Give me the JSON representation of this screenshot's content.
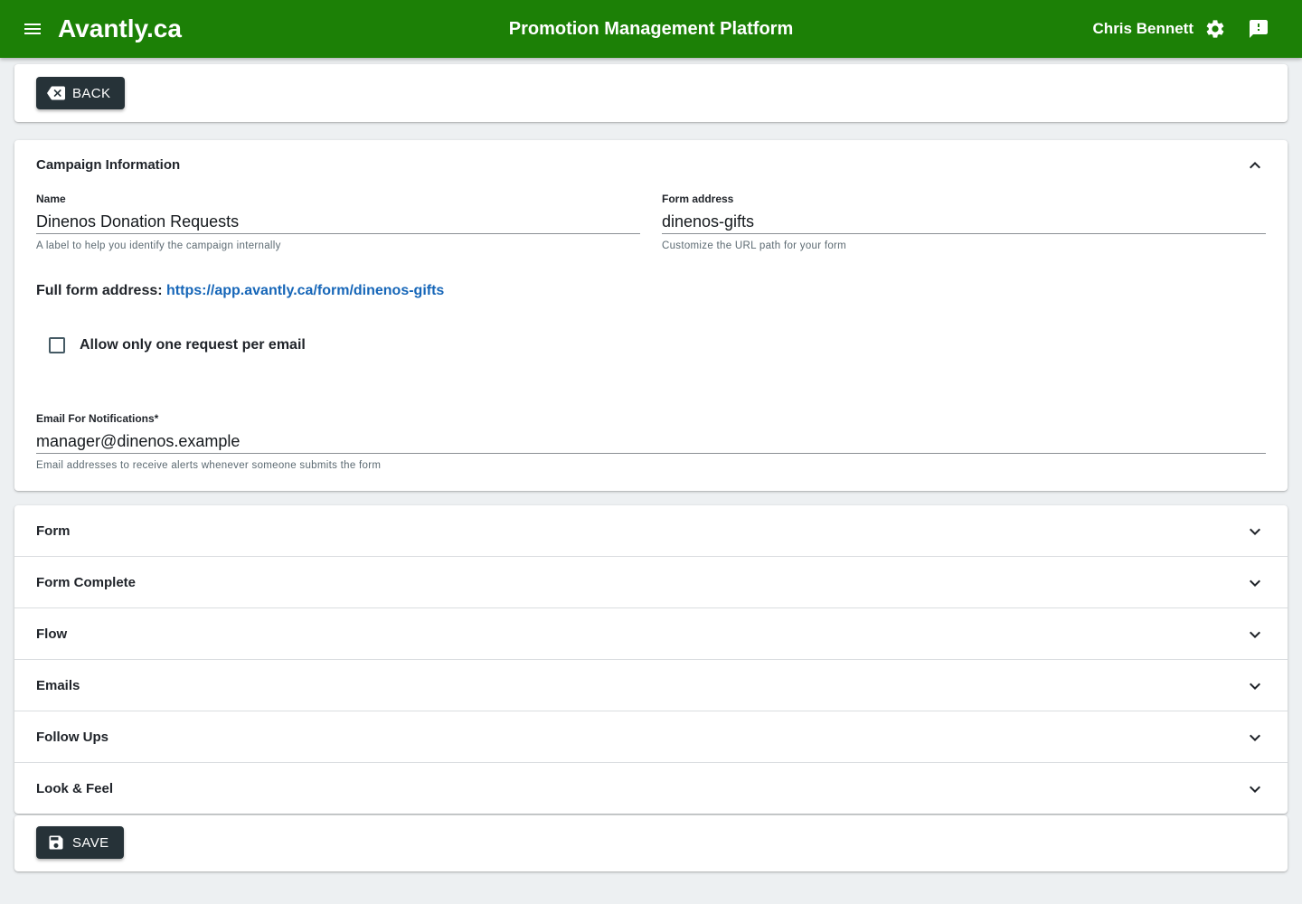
{
  "header": {
    "brand": "Avantly.ca",
    "title": "Promotion Management Platform",
    "user_name": "Chris Bennett",
    "bar_color": "#1c8006"
  },
  "back_card": {
    "back_label": "BACK"
  },
  "campaign": {
    "title": "Campaign Information",
    "name": {
      "label": "Name",
      "value": "Dinenos Donation Requests",
      "help": "A label to help you identify the campaign internally"
    },
    "form_address": {
      "label": "Form address",
      "value": "dinenos-gifts",
      "help": "Customize the URL path for your form"
    },
    "full_address_label": "Full form address: ",
    "full_address_url": "https://app.avantly.ca/form/dinenos-gifts",
    "one_request_label": "Allow only one request per email",
    "notifications": {
      "label": "Email For Notifications*",
      "value": "manager@dinenos.example",
      "help": "Email addresses to receive alerts whenever someone submits the form"
    }
  },
  "sections": [
    {
      "label": "Form"
    },
    {
      "label": "Form Complete"
    },
    {
      "label": "Flow"
    },
    {
      "label": "Emails"
    },
    {
      "label": "Follow Ups"
    },
    {
      "label": "Look & Feel"
    }
  ],
  "save_card": {
    "save_label": "SAVE"
  },
  "icons": {
    "menu": "menu-icon",
    "settings": "gear-icon",
    "feedback": "feedback-icon",
    "back": "backspace-icon",
    "save": "floppy-icon",
    "expand": "chevron-down-icon",
    "collapse": "chevron-up-icon"
  },
  "colors": {
    "button_dark": "#263238",
    "link": "#1666b8",
    "background": "#edf0f2"
  }
}
